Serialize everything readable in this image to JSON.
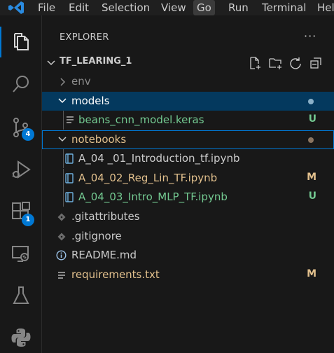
{
  "menu": [
    "File",
    "Edit",
    "Selection",
    "View",
    "Go",
    "Run",
    "Terminal",
    "Hel"
  ],
  "activity_badges": {
    "source_control": "4",
    "extensions": "1"
  },
  "explorer": {
    "title": "EXPLORER",
    "more": "···",
    "folder": "TF_LEARING_1"
  },
  "tree": [
    {
      "label": "env",
      "kind": "folder-collapsed",
      "status": ""
    },
    {
      "label": "models",
      "kind": "folder-expanded",
      "status": ""
    },
    {
      "label": "beans_cnn_model.keras",
      "kind": "file-lines",
      "status": "U"
    },
    {
      "label": "notebooks",
      "kind": "folder-expanded",
      "status": ""
    },
    {
      "label": "A_04 _01_Introduction_tf.ipynb",
      "kind": "notebook",
      "status": ""
    },
    {
      "label": "A_04_02_Reg_Lin_TF.ipynb",
      "kind": "notebook",
      "status": "M"
    },
    {
      "label": "A_04_03_Intro_MLP_TF.ipynb",
      "kind": "notebook",
      "status": "U"
    },
    {
      "label": ".gitattributes",
      "kind": "git",
      "status": ""
    },
    {
      "label": ".gitignore",
      "kind": "git",
      "status": ""
    },
    {
      "label": "README.md",
      "kind": "info",
      "status": ""
    },
    {
      "label": "requirements.txt",
      "kind": "file-lines",
      "status": "M"
    }
  ],
  "colors": {
    "accent": "#0078d4",
    "untracked": "#73c991",
    "modified": "#e2c08d",
    "selection": "#04395e"
  }
}
